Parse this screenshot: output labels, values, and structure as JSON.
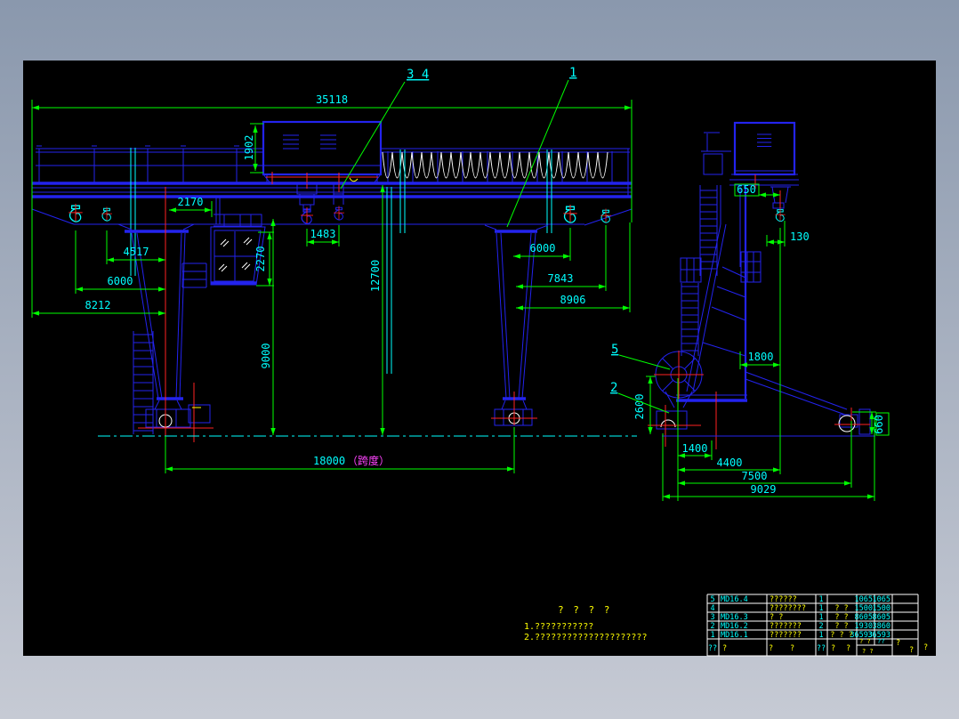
{
  "window": {
    "bg_top": "#8a98ad",
    "bg_bottom": "#c6cad4",
    "canvas_color": "#000000"
  },
  "palette": {
    "blue": "#2323ee",
    "cyan": "#00ffff",
    "green": "#00ff00",
    "red": "#ff2222",
    "white": "#ffffff",
    "yellow": "#ffff00",
    "magenta": "#ff44ff"
  },
  "front_view": {
    "dims": {
      "overall_length": "35118",
      "trolley_height": "1902",
      "leg_offset": "2170",
      "hook_spacing": "1483",
      "cab_height": "2270",
      "hook2_offset": "4517",
      "hook1_offset": "6000",
      "girder_end_offset": "8212",
      "rail_height": "12700",
      "lift_height": "9000",
      "right_hook1_offset": "6000",
      "right_hook2_offset": "7843",
      "right_end_offset": "8906",
      "span_value": "18000",
      "span_label": "（跨度）"
    }
  },
  "side_view": {
    "dims": {
      "hook_offset_650": "650",
      "hook_offset_130": "130",
      "leg_depth_1800": "1800",
      "reel_height_2600": "2600",
      "wheel_height_660": "660",
      "wheelbase_1400": "1400",
      "wheelbase_4400": "4400",
      "wheelbase_7500": "7500",
      "base_total_9029": "9029"
    }
  },
  "balloons": {
    "item_3_4": "3  4",
    "item_1": "1",
    "item_5": "5",
    "item_2": "2"
  },
  "notes": {
    "heading": "?  ?  ?  ?",
    "line1": "1.???????????",
    "line2": "2.?????????????????????"
  },
  "title_block": {
    "rows": [
      {
        "no": "5",
        "code": "MD16.4",
        "name": "??????",
        "qty": "1",
        "material": "",
        "unit_weight": "1065",
        "total_weight": "1065"
      },
      {
        "no": "4",
        "code": "",
        "name": "????????",
        "qty": "1",
        "material": "? ?",
        "unit_weight": "1500",
        "total_weight": "1500"
      },
      {
        "no": "3",
        "code": "MD16.3",
        "name": "? ?",
        "qty": "1",
        "material": "? ?",
        "unit_weight": "8605",
        "total_weight": "8605"
      },
      {
        "no": "2",
        "code": "MD16.2",
        "name": "???????",
        "qty": "2",
        "material": "? ?",
        "unit_weight": "1930",
        "total_weight": "3860"
      },
      {
        "no": "1",
        "code": "MD16.1",
        "name": "???????",
        "qty": "1",
        "material": "? ? ?",
        "unit_weight": "36593",
        "total_weight": "36593"
      }
    ],
    "footer": {
      "c1": "??",
      "c2": "?",
      "c3a": "?",
      "c3b": "?",
      "c4": "??",
      "c5a": "?",
      "c5b": "?",
      "sub_top": "? ?",
      "sub_right": "??",
      "sub_bottom": "? ?",
      "r1": "?",
      "r2": "?",
      "r3": "?"
    }
  }
}
